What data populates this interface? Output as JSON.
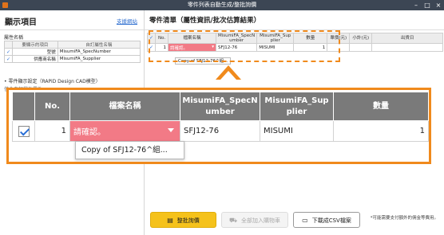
{
  "window": {
    "title": "零件列表自動生成/整批詢價"
  },
  "left_panel": {
    "title": "顯示項目",
    "help_link": "支援網站",
    "attr_section_label": "屬性名稱",
    "table_headers": [
      "要顯示的項目",
      "自訂屬性名稱"
    ],
    "rows": [
      {
        "checked": true,
        "label": "型號",
        "value": "MisumiFA_SpecNumber"
      },
      {
        "checked": true,
        "label": "供應商名稱",
        "value": "MisumiFA_Supplier"
      }
    ],
    "part_section_label": "• 零件顯示設定（RAPiD Design CAD模型）",
    "part_sub_label": "僅含自訂屬性零件"
  },
  "right_panel": {
    "title": "零件清單（屬性資訊/批次估算結果）",
    "mini_table": {
      "headers": [
        "",
        "No.",
        "檔案名稱",
        "MisumiFA_SpecNumber",
        "MisumiFA_Supplier",
        "數量",
        "單價(元)",
        "小計(元)",
        "出貨日"
      ],
      "row": {
        "checked": true,
        "no": "1",
        "file": "請確認。",
        "spec": "SFJ12-76",
        "supplier": "MISUMI",
        "qty": "1"
      },
      "popup": "Copy of SFJ12-76^組..."
    },
    "note": "*可能需要支付額外的佣金等費用。",
    "buttons": {
      "quote": "整批詢價",
      "cart": "全部加入購物車",
      "csv": "下載成CSV檔案"
    }
  },
  "zoom_table": {
    "headers": {
      "no": "No.",
      "file": "檔案名稱",
      "spec_line1": "MisumiFA_SpecN",
      "spec_line2": "umber",
      "supplier_line1": "MisumiFA_Sup",
      "supplier_line2": "plier",
      "qty": "數量"
    },
    "row": {
      "checked": true,
      "no": "1",
      "file": "請確認。",
      "spec": "SFJ12-76",
      "supplier": "MISUMI",
      "qty": "1"
    },
    "popup": "Copy of SFJ12-76^組..."
  },
  "colors": {
    "accent": "#f08a1c",
    "warning_cell": "#f27a86",
    "primary_button": "#f5c21b",
    "header_grey": "#7a7a7a"
  }
}
